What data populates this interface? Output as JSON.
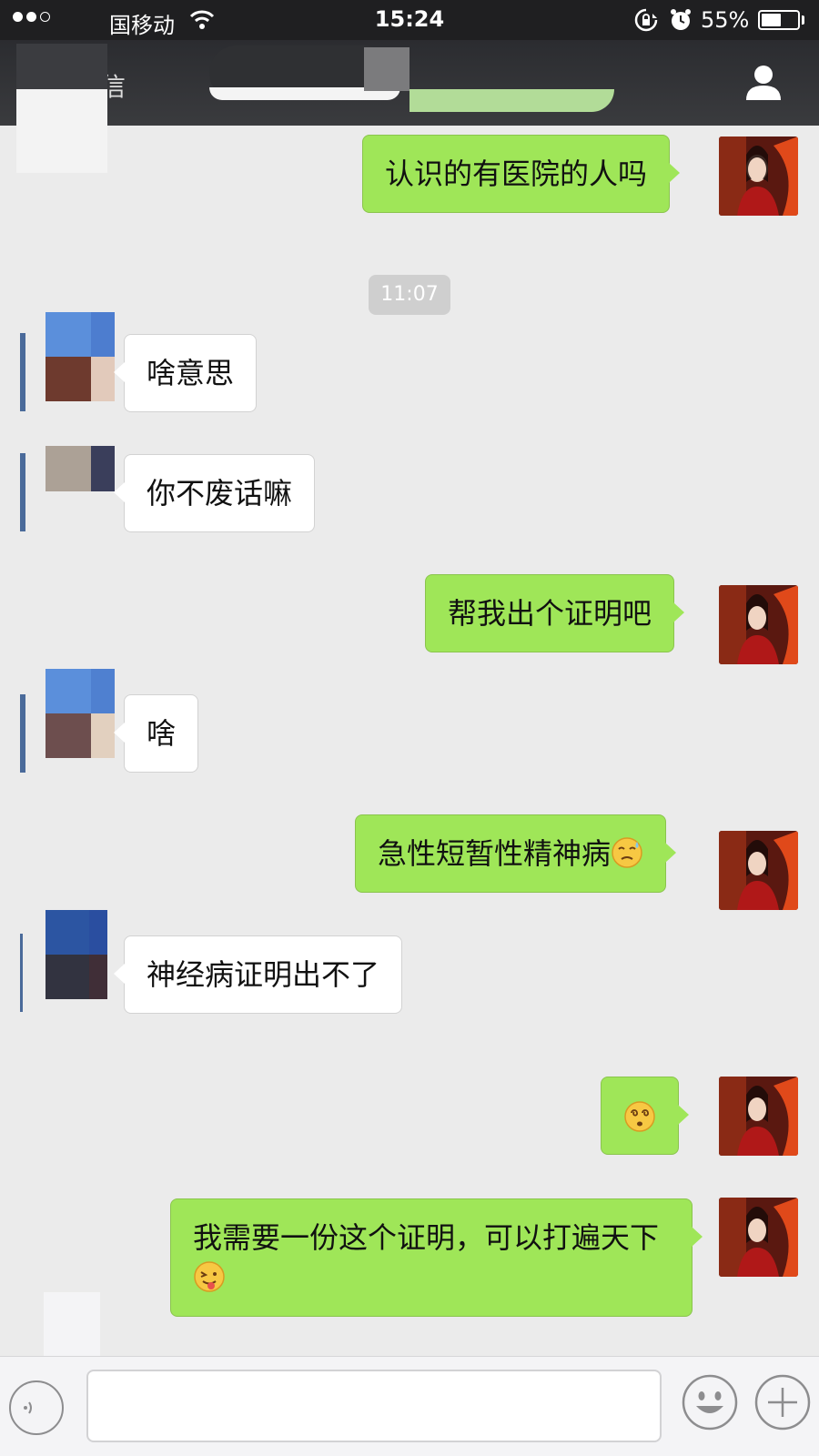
{
  "status_bar": {
    "carrier": "国移动",
    "time": "15:24",
    "battery_percent": "55%",
    "battery_level": 0.55
  },
  "nav": {
    "back_text": "信",
    "profile_icon": "user-icon"
  },
  "chat": {
    "timestamp": "11:07",
    "messages": [
      {
        "sender": "me",
        "text": "认识的有医院的人吗"
      },
      {
        "sender": "other",
        "text": "啥意思"
      },
      {
        "sender": "other",
        "text": "你不废话嘛"
      },
      {
        "sender": "me",
        "text": "帮我出个证明吧"
      },
      {
        "sender": "other",
        "text": "啥"
      },
      {
        "sender": "me",
        "text": "急性短暂性精神病",
        "emoji": "sweat-smile-emoji"
      },
      {
        "sender": "other",
        "text": "神经病证明出不了"
      },
      {
        "sender": "me",
        "text": "",
        "emoji": "dizzy-face-emoji"
      },
      {
        "sender": "me",
        "text": "我需要一份这个证明，可以打遍天下",
        "emoji": "tongue-out-emoji"
      }
    ]
  },
  "input_bar": {
    "value": "",
    "icons": [
      "voice-icon",
      "smiley-icon",
      "plus-icon"
    ]
  },
  "colors": {
    "my_bubble": "#9fe658",
    "other_bubble": "#ffffff",
    "chat_background": "#ebebeb",
    "nav_background": "#2b2c30"
  }
}
